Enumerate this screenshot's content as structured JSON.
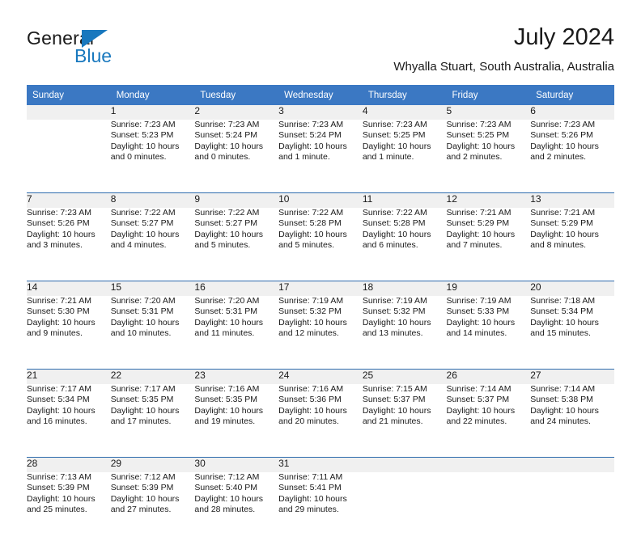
{
  "logo": {
    "word_top": "General",
    "word_bottom": "Blue",
    "triangle_color": "#1878be",
    "icon": "triangle-icon"
  },
  "header": {
    "title": "July 2024",
    "subtitle": "Whyalla Stuart, South Australia, Australia"
  },
  "theme": {
    "header_blue": "#3b78c3",
    "separator_blue": "#2e6bad",
    "daynum_band": "#f0f0f0",
    "text": "#1a1a1a"
  },
  "weekdays": [
    "Sunday",
    "Monday",
    "Tuesday",
    "Wednesday",
    "Thursday",
    "Friday",
    "Saturday"
  ],
  "weeks": [
    [
      {
        "day": "",
        "lines": []
      },
      {
        "day": "1",
        "lines": [
          "Sunrise: 7:23 AM",
          "Sunset: 5:23 PM",
          "Daylight: 10 hours",
          "and 0 minutes."
        ]
      },
      {
        "day": "2",
        "lines": [
          "Sunrise: 7:23 AM",
          "Sunset: 5:24 PM",
          "Daylight: 10 hours",
          "and 0 minutes."
        ]
      },
      {
        "day": "3",
        "lines": [
          "Sunrise: 7:23 AM",
          "Sunset: 5:24 PM",
          "Daylight: 10 hours",
          "and 1 minute."
        ]
      },
      {
        "day": "4",
        "lines": [
          "Sunrise: 7:23 AM",
          "Sunset: 5:25 PM",
          "Daylight: 10 hours",
          "and 1 minute."
        ]
      },
      {
        "day": "5",
        "lines": [
          "Sunrise: 7:23 AM",
          "Sunset: 5:25 PM",
          "Daylight: 10 hours",
          "and 2 minutes."
        ]
      },
      {
        "day": "6",
        "lines": [
          "Sunrise: 7:23 AM",
          "Sunset: 5:26 PM",
          "Daylight: 10 hours",
          "and 2 minutes."
        ]
      }
    ],
    [
      {
        "day": "7",
        "lines": [
          "Sunrise: 7:23 AM",
          "Sunset: 5:26 PM",
          "Daylight: 10 hours",
          "and 3 minutes."
        ]
      },
      {
        "day": "8",
        "lines": [
          "Sunrise: 7:22 AM",
          "Sunset: 5:27 PM",
          "Daylight: 10 hours",
          "and 4 minutes."
        ]
      },
      {
        "day": "9",
        "lines": [
          "Sunrise: 7:22 AM",
          "Sunset: 5:27 PM",
          "Daylight: 10 hours",
          "and 5 minutes."
        ]
      },
      {
        "day": "10",
        "lines": [
          "Sunrise: 7:22 AM",
          "Sunset: 5:28 PM",
          "Daylight: 10 hours",
          "and 5 minutes."
        ]
      },
      {
        "day": "11",
        "lines": [
          "Sunrise: 7:22 AM",
          "Sunset: 5:28 PM",
          "Daylight: 10 hours",
          "and 6 minutes."
        ]
      },
      {
        "day": "12",
        "lines": [
          "Sunrise: 7:21 AM",
          "Sunset: 5:29 PM",
          "Daylight: 10 hours",
          "and 7 minutes."
        ]
      },
      {
        "day": "13",
        "lines": [
          "Sunrise: 7:21 AM",
          "Sunset: 5:29 PM",
          "Daylight: 10 hours",
          "and 8 minutes."
        ]
      }
    ],
    [
      {
        "day": "14",
        "lines": [
          "Sunrise: 7:21 AM",
          "Sunset: 5:30 PM",
          "Daylight: 10 hours",
          "and 9 minutes."
        ]
      },
      {
        "day": "15",
        "lines": [
          "Sunrise: 7:20 AM",
          "Sunset: 5:31 PM",
          "Daylight: 10 hours",
          "and 10 minutes."
        ]
      },
      {
        "day": "16",
        "lines": [
          "Sunrise: 7:20 AM",
          "Sunset: 5:31 PM",
          "Daylight: 10 hours",
          "and 11 minutes."
        ]
      },
      {
        "day": "17",
        "lines": [
          "Sunrise: 7:19 AM",
          "Sunset: 5:32 PM",
          "Daylight: 10 hours",
          "and 12 minutes."
        ]
      },
      {
        "day": "18",
        "lines": [
          "Sunrise: 7:19 AM",
          "Sunset: 5:32 PM",
          "Daylight: 10 hours",
          "and 13 minutes."
        ]
      },
      {
        "day": "19",
        "lines": [
          "Sunrise: 7:19 AM",
          "Sunset: 5:33 PM",
          "Daylight: 10 hours",
          "and 14 minutes."
        ]
      },
      {
        "day": "20",
        "lines": [
          "Sunrise: 7:18 AM",
          "Sunset: 5:34 PM",
          "Daylight: 10 hours",
          "and 15 minutes."
        ]
      }
    ],
    [
      {
        "day": "21",
        "lines": [
          "Sunrise: 7:17 AM",
          "Sunset: 5:34 PM",
          "Daylight: 10 hours",
          "and 16 minutes."
        ]
      },
      {
        "day": "22",
        "lines": [
          "Sunrise: 7:17 AM",
          "Sunset: 5:35 PM",
          "Daylight: 10 hours",
          "and 17 minutes."
        ]
      },
      {
        "day": "23",
        "lines": [
          "Sunrise: 7:16 AM",
          "Sunset: 5:35 PM",
          "Daylight: 10 hours",
          "and 19 minutes."
        ]
      },
      {
        "day": "24",
        "lines": [
          "Sunrise: 7:16 AM",
          "Sunset: 5:36 PM",
          "Daylight: 10 hours",
          "and 20 minutes."
        ]
      },
      {
        "day": "25",
        "lines": [
          "Sunrise: 7:15 AM",
          "Sunset: 5:37 PM",
          "Daylight: 10 hours",
          "and 21 minutes."
        ]
      },
      {
        "day": "26",
        "lines": [
          "Sunrise: 7:14 AM",
          "Sunset: 5:37 PM",
          "Daylight: 10 hours",
          "and 22 minutes."
        ]
      },
      {
        "day": "27",
        "lines": [
          "Sunrise: 7:14 AM",
          "Sunset: 5:38 PM",
          "Daylight: 10 hours",
          "and 24 minutes."
        ]
      }
    ],
    [
      {
        "day": "28",
        "lines": [
          "Sunrise: 7:13 AM",
          "Sunset: 5:39 PM",
          "Daylight: 10 hours",
          "and 25 minutes."
        ]
      },
      {
        "day": "29",
        "lines": [
          "Sunrise: 7:12 AM",
          "Sunset: 5:39 PM",
          "Daylight: 10 hours",
          "and 27 minutes."
        ]
      },
      {
        "day": "30",
        "lines": [
          "Sunrise: 7:12 AM",
          "Sunset: 5:40 PM",
          "Daylight: 10 hours",
          "and 28 minutes."
        ]
      },
      {
        "day": "31",
        "lines": [
          "Sunrise: 7:11 AM",
          "Sunset: 5:41 PM",
          "Daylight: 10 hours",
          "and 29 minutes."
        ]
      },
      {
        "day": "",
        "lines": []
      },
      {
        "day": "",
        "lines": []
      },
      {
        "day": "",
        "lines": []
      }
    ]
  ]
}
